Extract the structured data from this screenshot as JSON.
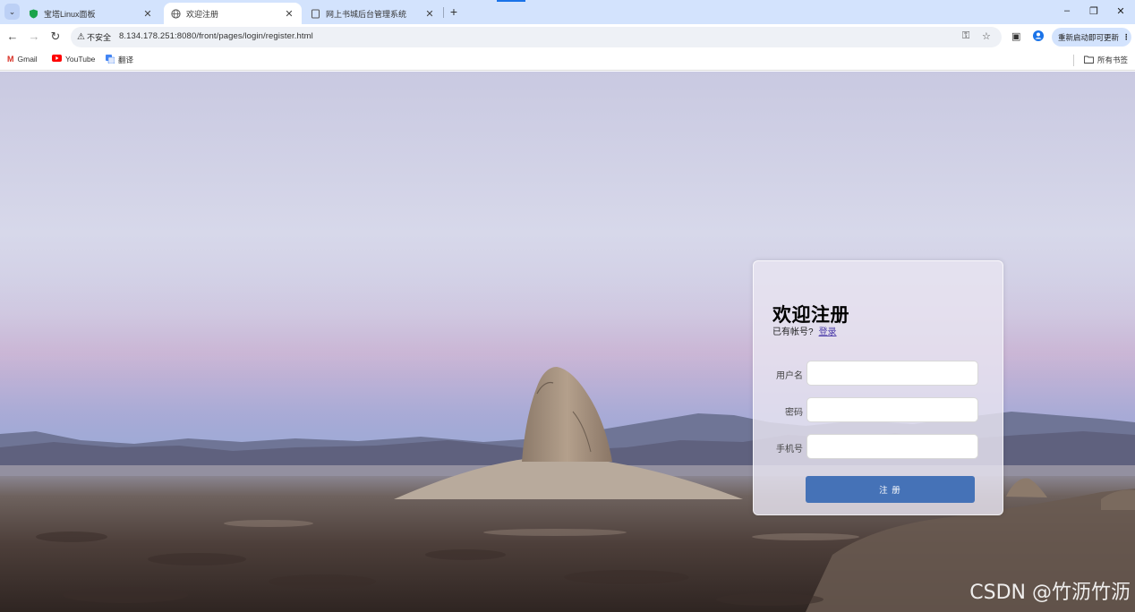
{
  "tabs": [
    {
      "title": "宝塔Linux面板",
      "active": false
    },
    {
      "title": "欢迎注册",
      "active": true
    },
    {
      "title": "网上书城后台管理系统",
      "active": false
    }
  ],
  "toolbar": {
    "security_label": "不安全",
    "url": "8.134.178.251:8080/front/pages/login/register.html",
    "update_button": "重新启动即可更新"
  },
  "bookmarks": {
    "items": [
      {
        "label": "Gmail",
        "icon": "gmail-icon"
      },
      {
        "label": "YouTube",
        "icon": "youtube-icon"
      },
      {
        "label": "翻译",
        "icon": "translate-icon"
      }
    ],
    "all_bookmarks": "所有书签"
  },
  "register": {
    "title": "欢迎注册",
    "hint": "已有帐号?",
    "login_link": "登录",
    "fields": [
      {
        "label": "用户名",
        "value": ""
      },
      {
        "label": "密码",
        "value": ""
      },
      {
        "label": "手机号",
        "value": ""
      }
    ],
    "submit": "注 册"
  },
  "watermark": "CSDN @竹沥竹沥",
  "colors": {
    "accent": "#4572b7",
    "tabstrip": "#d3e3fd"
  }
}
